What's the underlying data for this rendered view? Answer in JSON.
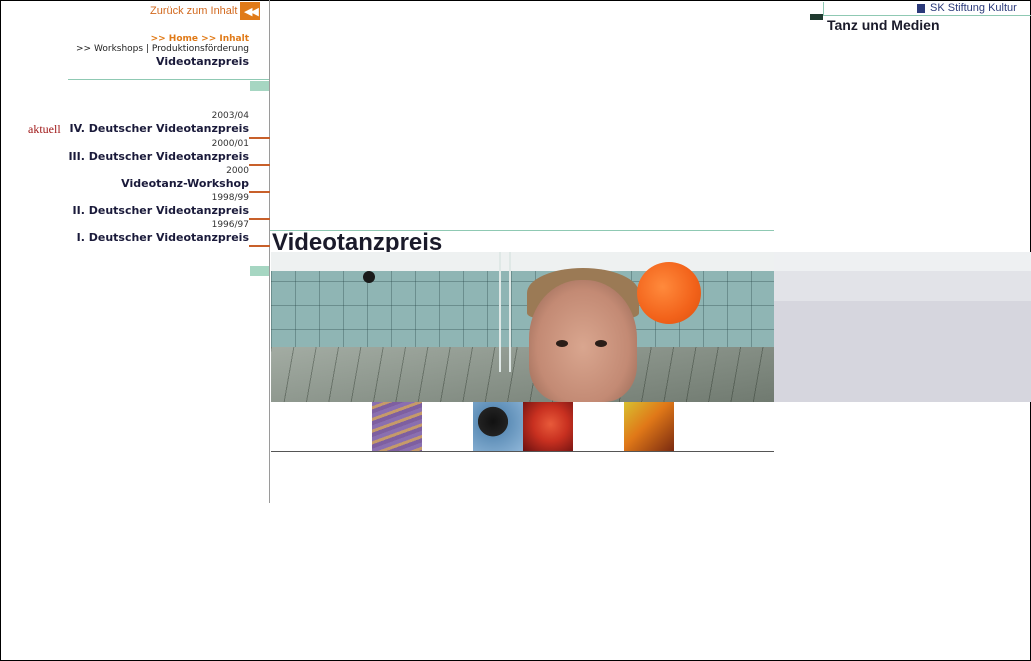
{
  "nav": {
    "back_label": "Zurück zum Inhalt",
    "back_icon": "double-chevron-left-icon",
    "breadcrumb": {
      "home": ">> Home",
      "inhalt": ">> Inhalt",
      "prefix": ">>",
      "workshops": "Workshops",
      "separator": "|",
      "produktion": "Produktionsförderung"
    },
    "page_subtitle": "Videotanzpreis",
    "aktuell": "aktuell",
    "items": [
      {
        "year": "2003/04",
        "title": "IV. Deutscher Videotanzpreis"
      },
      {
        "year": "2000/01",
        "title": "III. Deutscher Videotanzpreis"
      },
      {
        "year": "2000",
        "title": "Videotanz-Workshop"
      },
      {
        "year": "1998/99",
        "title": "II. Deutscher Videotanzpreis"
      },
      {
        "year": "1996/97",
        "title": "I. Deutscher Videotanzpreis"
      }
    ]
  },
  "header": {
    "brand": "SK Stiftung Kultur",
    "section_title": "Tanz und Medien"
  },
  "main": {
    "heading": "Videotanzpreis"
  },
  "colors": {
    "accent_orange": "#e07a18",
    "navy": "#1a1a3a",
    "green_line": "#8fc9b3",
    "aktuell_red": "#a01818"
  }
}
